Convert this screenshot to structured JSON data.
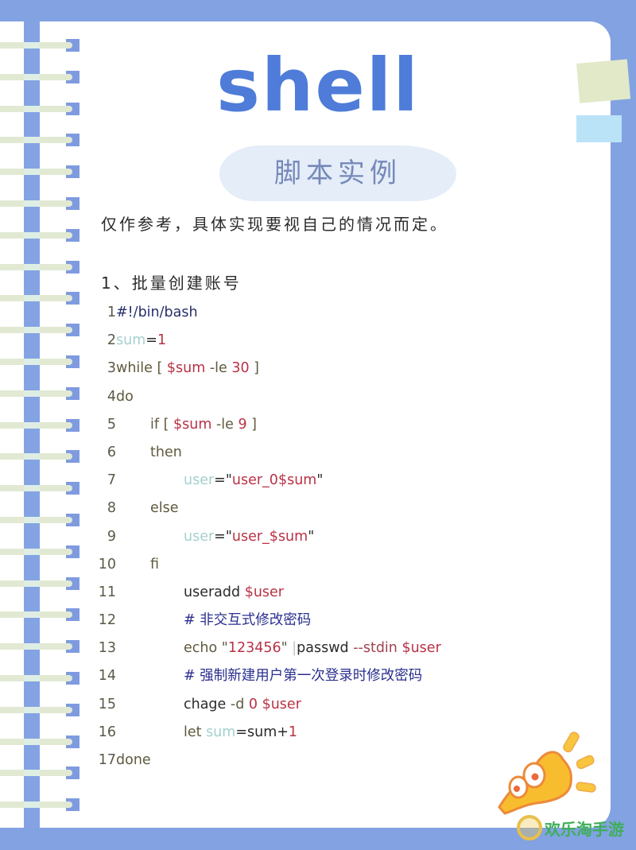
{
  "document": {
    "title": "shell",
    "subtitle": "脚本实例",
    "intro": "仅作参考，具体实现要视自己的情况而定。",
    "section_heading": "1、批量创建账号",
    "colors": {
      "frame": "#82a2e2",
      "title": "#4e7cd8",
      "pill_bg": "#e4edf8",
      "pill_text": "#7689b9",
      "keyword": "#5f5a3e",
      "variable_faded": "#a4d0cf",
      "string_number": "#b83246",
      "comment": "#2a2f8e",
      "shebang": "#27306a"
    }
  },
  "code": {
    "language": "bash",
    "lines": [
      {
        "n": "1",
        "indent": 0,
        "tokens": [
          {
            "t": "#!/bin/bash",
            "k": "shebang"
          }
        ]
      },
      {
        "n": "2",
        "indent": 0,
        "tokens": [
          {
            "t": "sum",
            "k": "var"
          },
          {
            "t": "=",
            "k": "plain"
          },
          {
            "t": "1",
            "k": "red"
          }
        ]
      },
      {
        "n": "3",
        "indent": 0,
        "tokens": [
          {
            "t": "while [ ",
            "k": "kw"
          },
          {
            "t": "$sum",
            "k": "red"
          },
          {
            "t": " -le ",
            "k": "kw"
          },
          {
            "t": "30",
            "k": "red"
          },
          {
            "t": " ]",
            "k": "kw"
          }
        ]
      },
      {
        "n": "4",
        "indent": 0,
        "tokens": [
          {
            "t": "do",
            "k": "kw"
          }
        ]
      },
      {
        "n": "5",
        "indent": 1,
        "tokens": [
          {
            "t": "if [ ",
            "k": "kw"
          },
          {
            "t": "$sum",
            "k": "red"
          },
          {
            "t": " -le ",
            "k": "kw"
          },
          {
            "t": "9",
            "k": "red"
          },
          {
            "t": " ]",
            "k": "kw"
          }
        ]
      },
      {
        "n": "6",
        "indent": 1,
        "tokens": [
          {
            "t": "then",
            "k": "kw"
          }
        ]
      },
      {
        "n": "7",
        "indent": 2,
        "tokens": [
          {
            "t": "user",
            "k": "var"
          },
          {
            "t": "=\"",
            "k": "plain"
          },
          {
            "t": "user_0$sum",
            "k": "red"
          },
          {
            "t": "\"",
            "k": "plain"
          }
        ]
      },
      {
        "n": "8",
        "indent": 1,
        "tokens": [
          {
            "t": "else",
            "k": "kw"
          }
        ]
      },
      {
        "n": "9",
        "indent": 2,
        "tokens": [
          {
            "t": "user",
            "k": "var"
          },
          {
            "t": "=\"",
            "k": "plain"
          },
          {
            "t": "user_$sum",
            "k": "red"
          },
          {
            "t": "\"",
            "k": "plain"
          }
        ]
      },
      {
        "n": "10",
        "indent": 1,
        "tokens": [
          {
            "t": "fi",
            "k": "kw"
          }
        ]
      },
      {
        "n": "11",
        "indent": 2,
        "tokens": [
          {
            "t": "useradd ",
            "k": "plain"
          },
          {
            "t": "$user",
            "k": "red"
          }
        ]
      },
      {
        "n": "12",
        "indent": 2,
        "tokens": [
          {
            "t": "# 非交互式修改密码",
            "k": "comment"
          }
        ]
      },
      {
        "n": "13",
        "indent": 2,
        "tokens": [
          {
            "t": "echo ",
            "k": "kw"
          },
          {
            "t": "\"",
            "k": "kw"
          },
          {
            "t": "123456",
            "k": "red"
          },
          {
            "t": "\" ",
            "k": "kw"
          },
          {
            "t": "|",
            "k": "mark"
          },
          {
            "t": "passwd ",
            "k": "plain"
          },
          {
            "t": "--stdin ",
            "k": "opt"
          },
          {
            "t": "$user",
            "k": "red"
          }
        ]
      },
      {
        "n": "14",
        "indent": 2,
        "tokens": [
          {
            "t": "# 强制新建用户第一次登录时修改密码",
            "k": "comment"
          }
        ]
      },
      {
        "n": "15",
        "indent": 2,
        "tokens": [
          {
            "t": "chage ",
            "k": "plain"
          },
          {
            "t": "-d ",
            "k": "kw"
          },
          {
            "t": "0 ",
            "k": "red"
          },
          {
            "t": "$user",
            "k": "red"
          }
        ]
      },
      {
        "n": "16",
        "indent": 2,
        "tokens": [
          {
            "t": "let ",
            "k": "kw"
          },
          {
            "t": "sum",
            "k": "var"
          },
          {
            "t": "=sum+",
            "k": "plain"
          },
          {
            "t": "1",
            "k": "red"
          }
        ]
      },
      {
        "n": "17",
        "indent": 0,
        "tokens": [
          {
            "t": "done",
            "k": "kw"
          }
        ]
      }
    ]
  },
  "decor": {
    "spiral_ring_count": 25,
    "mascot": "yellow-megaphone-creature",
    "watermark": {
      "text": "欢乐淘手游",
      "icon": "laughing-face-icon"
    }
  }
}
